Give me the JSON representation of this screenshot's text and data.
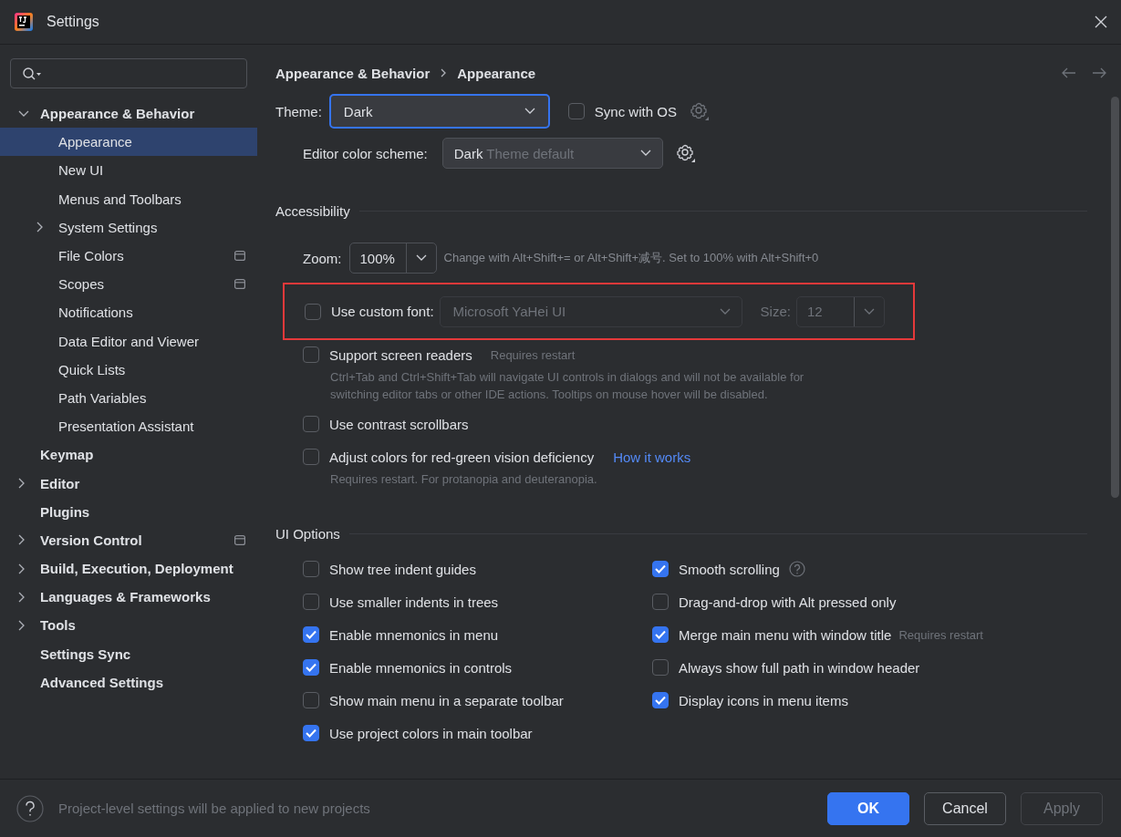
{
  "window": {
    "title": "Settings"
  },
  "sidebar": {
    "items": [
      {
        "label": "Appearance & Behavior",
        "selected": false,
        "expandable": true,
        "expanded": true,
        "project_level": false,
        "children": [
          {
            "label": "Appearance",
            "selected": true,
            "expandable": false,
            "project_level": false
          },
          {
            "label": "New UI",
            "selected": false,
            "expandable": false,
            "project_level": false
          },
          {
            "label": "Menus and Toolbars",
            "selected": false,
            "expandable": false,
            "project_level": false
          },
          {
            "label": "System Settings",
            "selected": false,
            "expandable": true,
            "expanded": false,
            "project_level": false
          },
          {
            "label": "File Colors",
            "selected": false,
            "expandable": false,
            "project_level": true
          },
          {
            "label": "Scopes",
            "selected": false,
            "expandable": false,
            "project_level": true
          },
          {
            "label": "Notifications",
            "selected": false,
            "expandable": false,
            "project_level": false
          },
          {
            "label": "Data Editor and Viewer",
            "selected": false,
            "expandable": false,
            "project_level": false
          },
          {
            "label": "Quick Lists",
            "selected": false,
            "expandable": false,
            "project_level": false
          },
          {
            "label": "Path Variables",
            "selected": false,
            "expandable": false,
            "project_level": false
          },
          {
            "label": "Presentation Assistant",
            "selected": false,
            "expandable": false,
            "project_level": false
          }
        ]
      },
      {
        "label": "Keymap",
        "selected": false,
        "expandable": false,
        "project_level": false
      },
      {
        "label": "Editor",
        "selected": false,
        "expandable": true,
        "expanded": false,
        "project_level": false
      },
      {
        "label": "Plugins",
        "selected": false,
        "expandable": false,
        "project_level": false
      },
      {
        "label": "Version Control",
        "selected": false,
        "expandable": true,
        "expanded": false,
        "project_level": true
      },
      {
        "label": "Build, Execution, Deployment",
        "selected": false,
        "expandable": true,
        "expanded": false,
        "project_level": false
      },
      {
        "label": "Languages & Frameworks",
        "selected": false,
        "expandable": true,
        "expanded": false,
        "project_level": false
      },
      {
        "label": "Tools",
        "selected": false,
        "expandable": true,
        "expanded": false,
        "project_level": false
      },
      {
        "label": "Settings Sync",
        "selected": false,
        "expandable": false,
        "project_level": false
      },
      {
        "label": "Advanced Settings",
        "selected": false,
        "expandable": false,
        "project_level": false
      }
    ]
  },
  "breadcrumb": [
    "Appearance & Behavior",
    "Appearance"
  ],
  "theme": {
    "label": "Theme:",
    "value": "Dark",
    "focused": true
  },
  "sync_with_os": {
    "label": "Sync with OS",
    "checked": false
  },
  "color_scheme": {
    "label": "Editor color scheme:",
    "value": "Dark",
    "hint": "Theme default"
  },
  "accessibility": {
    "title": "Accessibility",
    "zoom": {
      "label": "Zoom:",
      "value": "100%",
      "hint": "Change with Alt+Shift+= or Alt+Shift+减号. Set to 100% with Alt+Shift+0"
    },
    "custom_font": {
      "label": "Use custom font:",
      "checked": false,
      "font": "Microsoft YaHei UI",
      "size_label": "Size:",
      "size": "12",
      "disabled": true,
      "highlighted": true
    },
    "options": [
      {
        "label": "Support screen readers",
        "checked": false,
        "note": "Requires restart",
        "description": "Ctrl+Tab and Ctrl+Shift+Tab will navigate UI controls in dialogs and will not be available for switching editor tabs or other IDE actions. Tooltips on mouse hover will be disabled."
      },
      {
        "label": "Use contrast scrollbars",
        "checked": false
      },
      {
        "label": "Adjust colors for red-green vision deficiency",
        "checked": false,
        "link": "How it works",
        "description": "Requires restart. For protanopia and deuteranopia."
      }
    ]
  },
  "ui_options": {
    "title": "UI Options",
    "columns": [
      [
        {
          "label": "Show tree indent guides",
          "checked": false
        },
        {
          "label": "Use smaller indents in trees",
          "checked": false
        },
        {
          "label": "Enable mnemonics in menu",
          "checked": true
        },
        {
          "label": "Enable mnemonics in controls",
          "checked": true
        },
        {
          "label": "Show main menu in a separate toolbar",
          "checked": false
        },
        {
          "label": "Use project colors in main toolbar",
          "checked": true
        }
      ],
      [
        {
          "label": "Smooth scrolling",
          "checked": true,
          "help": true
        },
        {
          "label": "Drag-and-drop with Alt pressed only",
          "checked": false
        },
        {
          "label": "Merge main menu with window title",
          "checked": true,
          "note": "Requires restart"
        },
        {
          "label": "Always show full path in window header",
          "checked": false
        },
        {
          "label": "Display icons in menu items",
          "checked": true
        }
      ]
    ]
  },
  "footer": {
    "text": "Project-level settings will be applied to new projects",
    "buttons": [
      {
        "label": "OK",
        "kind": "primary"
      },
      {
        "label": "Cancel",
        "kind": "default"
      },
      {
        "label": "Apply",
        "kind": "disabled"
      }
    ]
  }
}
